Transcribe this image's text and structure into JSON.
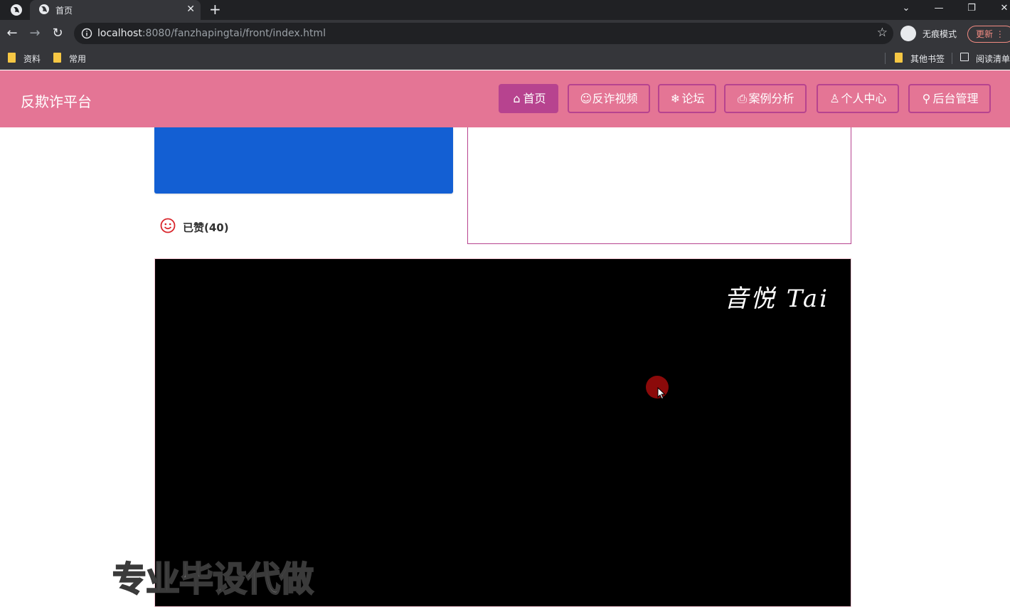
{
  "browser": {
    "tab_title": "首页",
    "url_host": "localhost",
    "url_rest": ":8080/fanzhapingtai/front/index.html",
    "profile_label": "无痕模式",
    "update_label": "更新",
    "bookmarks": [
      "资料",
      "常用"
    ],
    "bookmarks_right": [
      "其他书签",
      "阅读清单"
    ]
  },
  "header": {
    "brand": "反欺诈平台",
    "nav": [
      {
        "label": "首页",
        "icon": "home-icon",
        "active": true
      },
      {
        "label": "反诈视频",
        "icon": "video-icon",
        "active": false
      },
      {
        "label": "论坛",
        "icon": "snowflake-icon",
        "active": false
      },
      {
        "label": "案例分析",
        "icon": "printer-icon",
        "active": false
      },
      {
        "label": "个人中心",
        "icon": "user-icon",
        "active": false
      },
      {
        "label": "后台管理",
        "icon": "link-icon",
        "active": false
      }
    ],
    "colors": {
      "bar": "#e47595",
      "accent": "#b7438f"
    }
  },
  "content": {
    "like_text": "已赞(40)",
    "card_color": "#135fd3"
  },
  "video": {
    "watermark": "音悦 Tai"
  },
  "overlay": {
    "text": "专业毕设代做"
  }
}
